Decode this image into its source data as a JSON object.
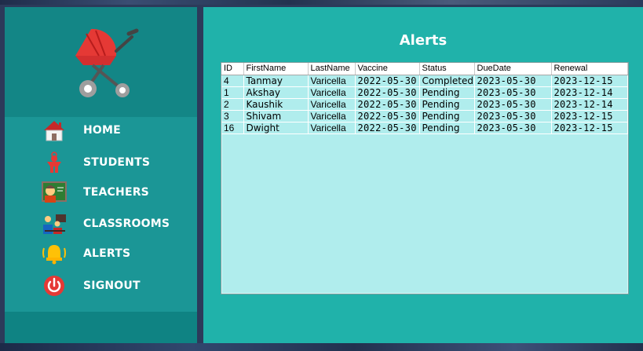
{
  "sidebar": {
    "logo_icon": "baby-stroller",
    "menu": [
      {
        "key": "home",
        "label": "HOME",
        "icon": "house-icon"
      },
      {
        "key": "students",
        "label": "STUDENTS",
        "icon": "child-icon"
      },
      {
        "key": "teachers",
        "label": "TEACHERS",
        "icon": "teacher-icon"
      },
      {
        "key": "classrooms",
        "label": "CLASSROOMS",
        "icon": "classroom-icon"
      },
      {
        "key": "alerts",
        "label": "ALERTS",
        "icon": "bell-icon"
      },
      {
        "key": "signout",
        "label": "SIGNOUT",
        "icon": "power-icon"
      }
    ]
  },
  "main": {
    "title": "Alerts",
    "table": {
      "headers": [
        "ID",
        "FirstName",
        "LastName",
        "Vaccine",
        "Status",
        "DueDate",
        "Renewal"
      ],
      "rows": [
        [
          "4",
          "Tanmay",
          "Varicella",
          "2022-05-30",
          "Completed",
          "2023-05-30",
          "2023-12-15"
        ],
        [
          "1",
          "Akshay",
          "Varicella",
          "2022-05-30",
          "Pending",
          "2023-05-30",
          "2023-12-14"
        ],
        [
          "2",
          "Kaushik",
          "Varicella",
          "2022-05-30",
          "Pending",
          "2023-05-30",
          "2023-12-14"
        ],
        [
          "3",
          "Shivam",
          "Varicella",
          "2022-05-30",
          "Pending",
          "2023-05-30",
          "2023-12-15"
        ],
        [
          "16",
          "Dwight",
          "Varicella",
          "2022-05-30",
          "Pending",
          "2023-05-30",
          "2023-12-15"
        ]
      ]
    }
  },
  "colors": {
    "sidebar_bg": "#0f8383",
    "sidebar_menu_bg": "#1b9696",
    "main_bg": "#20b2aa",
    "table_bg": "#b0eded"
  }
}
